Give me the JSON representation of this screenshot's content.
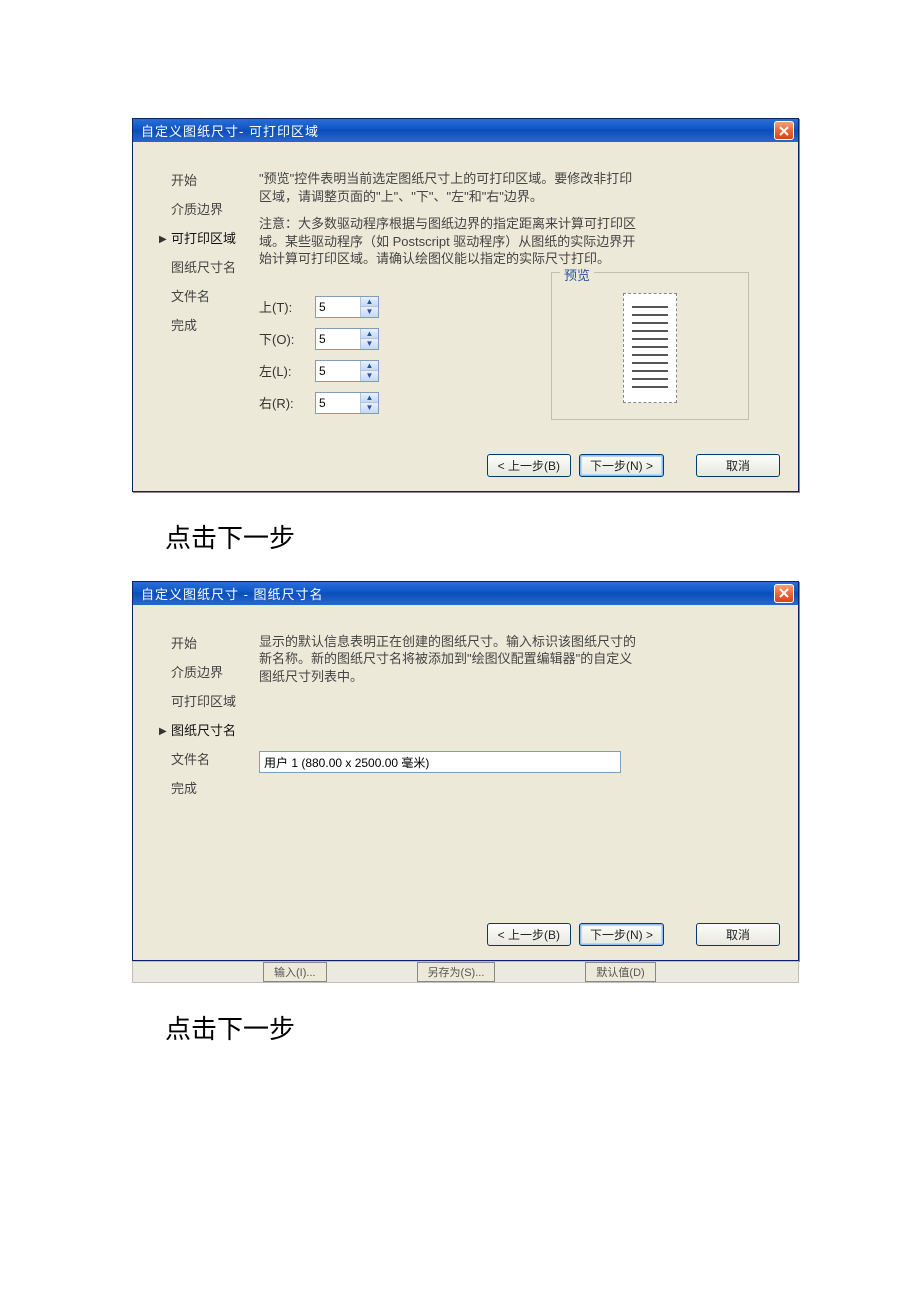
{
  "dialog1": {
    "title": "自定义图纸尺寸- 可打印区域",
    "steps": {
      "s1": "开始",
      "s2": "介质边界",
      "s3": "可打印区域",
      "s4": "图纸尺寸名",
      "s5": "文件名",
      "s6": "完成"
    },
    "help1": "\"预览\"控件表明当前选定图纸尺寸上的可打印区域。要修改非打印区域，请调整页面的\"上\"、\"下\"、\"左\"和\"右\"边界。",
    "help2": "注意：大多数驱动程序根据与图纸边界的指定距离来计算可打印区域。某些驱动程序（如 Postscript 驱动程序）从图纸的实际边界开始计算可打印区域。请确认绘图仪能以指定的实际尺寸打印。",
    "labels": {
      "top": "上(T):",
      "bottom": "下(O):",
      "left": "左(L):",
      "right": "右(R):"
    },
    "values": {
      "top": "5",
      "bottom": "5",
      "left": "5",
      "right": "5"
    },
    "preview_label": "预览",
    "buttons": {
      "back": "< 上一步(B)",
      "next": "下一步(N) >",
      "cancel": "取消"
    }
  },
  "caption1": "点击下一步",
  "dialog2": {
    "title": "自定义图纸尺寸 - 图纸尺寸名",
    "steps": {
      "s1": "开始",
      "s2": "介质边界",
      "s3": "可打印区域",
      "s4": "图纸尺寸名",
      "s5": "文件名",
      "s6": "完成"
    },
    "help": "显示的默认信息表明正在创建的图纸尺寸。输入标识该图纸尺寸的新名称。新的图纸尺寸名将被添加到\"绘图仪配置编辑器\"的自定义图纸尺寸列表中。",
    "name_value": "用户 1 (880.00 x 2500.00 毫米)",
    "buttons": {
      "back": "< 上一步(B)",
      "next": "下一步(N) >",
      "cancel": "取消"
    }
  },
  "ghostbar": {
    "b1": "输入(I)...",
    "b2": "另存为(S)...",
    "b3": "默认值(D)"
  },
  "caption2": "点击下一步"
}
